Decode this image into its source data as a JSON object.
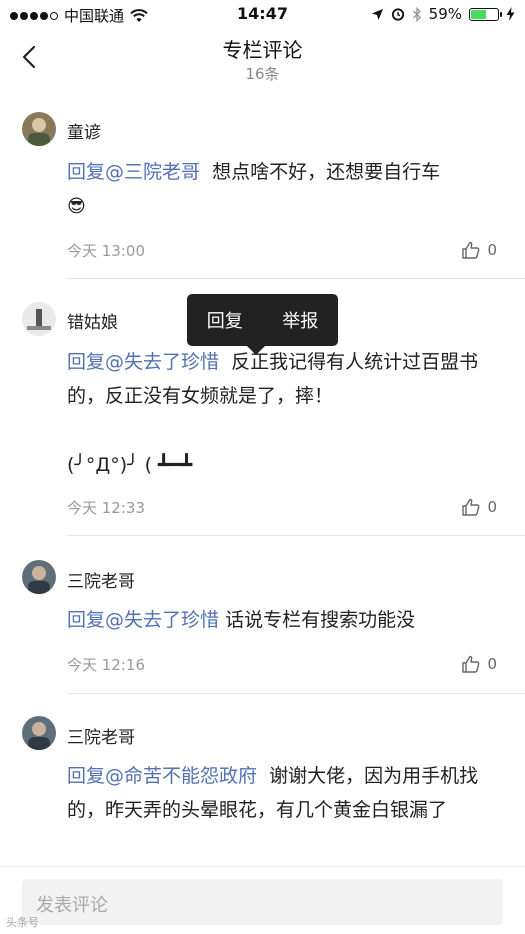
{
  "status_bar": {
    "carrier": "中国联通",
    "time": "14:47",
    "battery": "59%",
    "battery_level": 0.59
  },
  "nav": {
    "title": "专栏评论",
    "count": "16条"
  },
  "comments": [
    {
      "username": "童谚",
      "mention": "回复@三院老哥",
      "text": "想点啥不好，还想要自行车",
      "emoji": "😎",
      "time": "今天 13:00",
      "likes": "0"
    },
    {
      "username": "错姑娘",
      "mention": "回复@失去了珍惜",
      "text": "反正我记得有人统计过百盟书的，反正没有女频就是了，摔！",
      "kaomoji": "(╯°Д°)╯ ( ┻━┻",
      "time": "今天 12:33",
      "likes": "0"
    },
    {
      "username": "三院老哥",
      "mention": "回复@失去了珍惜",
      "text": "话说专栏有搜索功能没",
      "time": "今天 12:16",
      "likes": "0"
    },
    {
      "username": "三院老哥",
      "mention": "回复@命苦不能怨政府",
      "text": "谢谢大佬，因为用手机找的，昨天弄的头晕眼花，有几个黄金白银漏了"
    }
  ],
  "popover": {
    "reply": "回复",
    "report": "举报"
  },
  "input": {
    "placeholder": "发表评论"
  },
  "watermark": "头条号"
}
